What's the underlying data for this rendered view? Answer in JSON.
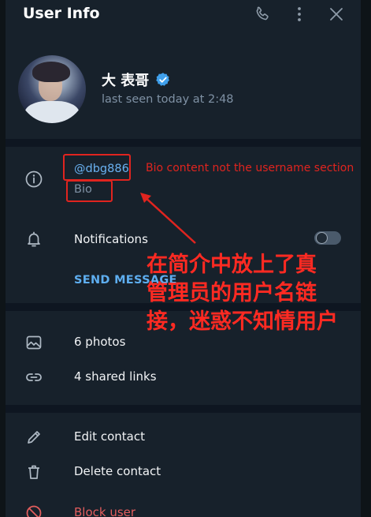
{
  "header": {
    "title": "User Info",
    "icons": [
      "phone-icon",
      "more-vertical-icon",
      "close-icon"
    ]
  },
  "profile": {
    "name": "大 表哥",
    "verified": true,
    "status": "last seen today at 2:48"
  },
  "info": {
    "username": "@dbg886",
    "bio_label": "Bio"
  },
  "notifications": {
    "label": "Notifications",
    "enabled": false
  },
  "send_message_label": "SEND MESSAGE",
  "media": {
    "photos": "6 photos",
    "links": "4 shared links"
  },
  "actions": {
    "edit": "Edit contact",
    "delete": "Delete contact",
    "block": "Block user"
  },
  "annotations": {
    "english_note": "Bio content not the username section",
    "chinese_note": [
      "在简介中放上了真",
      "管理员的用户名链",
      "接，迷惑不知情用户"
    ],
    "color": "#e0241f"
  },
  "colors": {
    "panel_bg": "#17212b",
    "accent": "#6ab2f2",
    "muted": "#7f91a4",
    "danger": "#e35d5d"
  }
}
